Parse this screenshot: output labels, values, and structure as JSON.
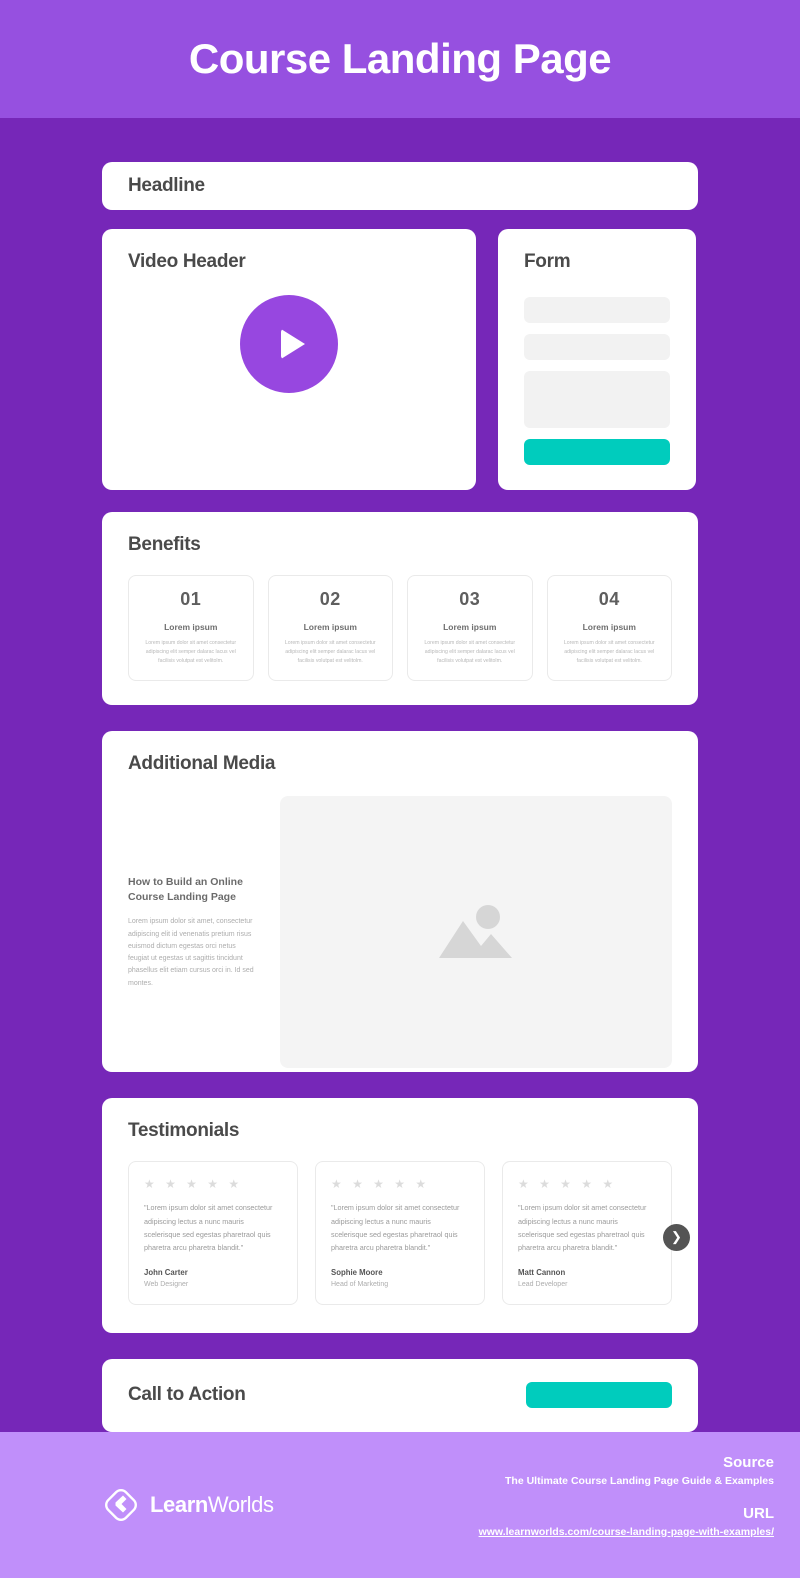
{
  "header": {
    "title": "Course Landing Page"
  },
  "colors": {
    "header_purple": "#9650E0",
    "body_purple": "#7627B8",
    "footer_purple": "#C08FFA",
    "accent_teal": "#00CCBD",
    "play_purple": "#9747E0"
  },
  "sections": {
    "headline": {
      "title": "Headline"
    },
    "video": {
      "title": "Video Header",
      "play_icon": "play-icon"
    },
    "form": {
      "title": "Form",
      "fields": [
        {
          "type": "short"
        },
        {
          "type": "short"
        },
        {
          "type": "tall"
        }
      ],
      "submit_label": ""
    },
    "benefits": {
      "title": "Benefits",
      "items": [
        {
          "number": "01",
          "subtitle": "Lorem ipsum",
          "body": "Lorem ipsum dolor sit amet consectetur adipiscing elit semper dalarac lacus vel facilisis volutpat est velitolm."
        },
        {
          "number": "02",
          "subtitle": "Lorem ipsum",
          "body": "Lorem ipsum dolor sit amet consectetur adipiscing elit semper dalarac lacus vel facilisis volutpat est velitolm."
        },
        {
          "number": "03",
          "subtitle": "Lorem ipsum",
          "body": "Lorem ipsum dolor sit amet consectetur adipiscing elit semper dalarac lacus vel facilisis volutpat est velitolm."
        },
        {
          "number": "04",
          "subtitle": "Lorem ipsum",
          "body": "Lorem ipsum dolor sit amet consectetur adipiscing elit semper dalarac lacus vel facilisis volutpat est velitolm."
        }
      ]
    },
    "additional_media": {
      "title": "Additional Media",
      "heading": "How to Build an Online Course Landing Page",
      "body": "Lorem ipsum dolor sit amet, consectetur adipiscing elit id venenatis pretium risus euismod dictum egestas orci netus feugiat ut egestas ut sagittis tincidunt phasellus elit etiam cursus orci in. Id sed montes.",
      "image_placeholder_icon": "image-placeholder-icon"
    },
    "testimonials": {
      "title": "Testimonials",
      "next_icon": "chevron-right-icon",
      "items": [
        {
          "stars": "★ ★ ★ ★ ★",
          "quote": "\"Lorem ipsum dolor sit amet consectetur adipiscing lectus a nunc mauris scelerisque sed egestas pharetraol quis pharetra arcu pharetra blandit.\"",
          "name": "John Carter",
          "role": "Web Designer"
        },
        {
          "stars": "★ ★ ★ ★ ★",
          "quote": "\"Lorem ipsum dolor sit amet consectetur adipiscing lectus a nunc mauris scelerisque sed egestas pharetraol quis pharetra arcu pharetra blandit.\"",
          "name": "Sophie Moore",
          "role": "Head of Marketing"
        },
        {
          "stars": "★ ★ ★ ★ ★",
          "quote": "\"Lorem ipsum dolor sit amet consectetur adipiscing lectus a nunc mauris scelerisque sed egestas pharetraol quis pharetra arcu pharetra blandit.\"",
          "name": "Matt Cannon",
          "role": "Lead Developer"
        }
      ]
    },
    "call_to_action": {
      "title": "Call to Action",
      "button_label": ""
    }
  },
  "footer": {
    "brand_bold": "Learn",
    "brand_light": "Worlds",
    "logo_icon": "learnworlds-logo-icon",
    "source_label": "Source",
    "source_value": "The Ultimate Course Landing Page Guide & Examples",
    "url_label": "URL",
    "url_value": "www.learnworlds.com/course-landing-page-with-examples/"
  }
}
